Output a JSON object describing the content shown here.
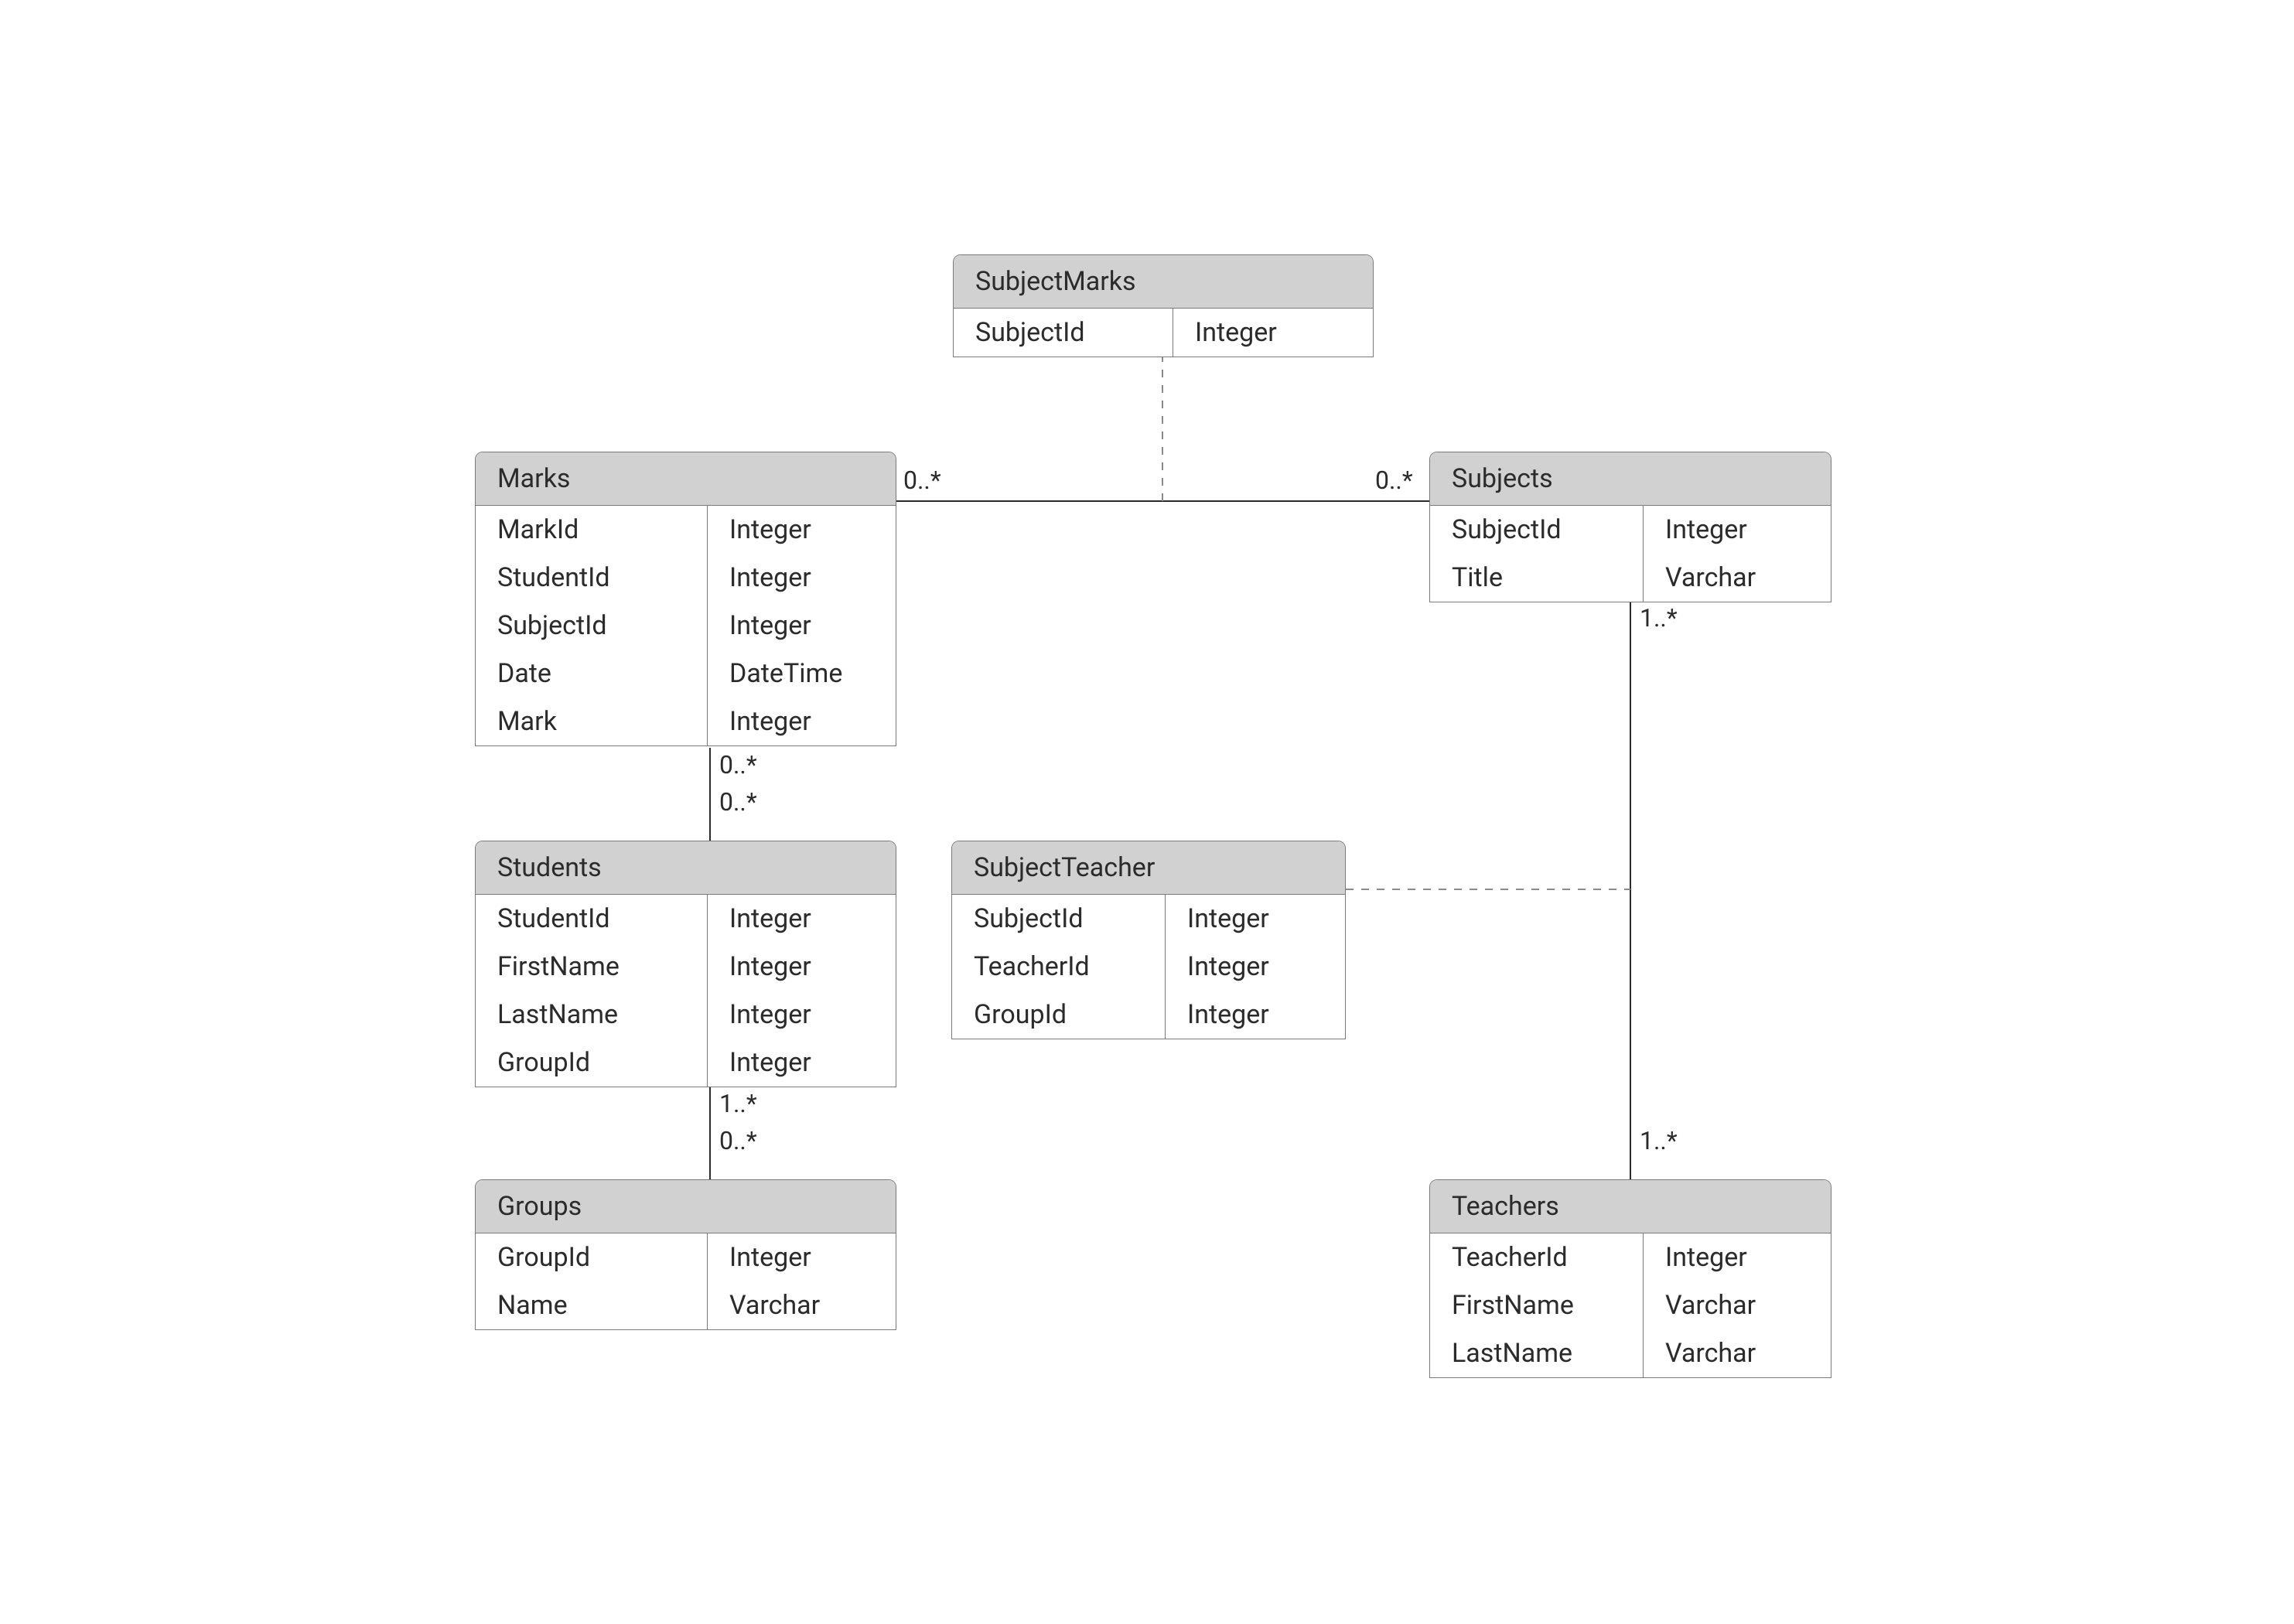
{
  "entities": {
    "subjectMarks": {
      "title": "SubjectMarks",
      "rows": [
        {
          "name": "SubjectId",
          "type": "Integer"
        }
      ]
    },
    "marks": {
      "title": "Marks",
      "rows": [
        {
          "name": "MarkId",
          "type": "Integer"
        },
        {
          "name": "StudentId",
          "type": "Integer"
        },
        {
          "name": "SubjectId",
          "type": "Integer"
        },
        {
          "name": "Date",
          "type": "DateTime"
        },
        {
          "name": "Mark",
          "type": "Integer"
        }
      ]
    },
    "subjects": {
      "title": "Subjects",
      "rows": [
        {
          "name": "SubjectId",
          "type": "Integer"
        },
        {
          "name": "Title",
          "type": "Varchar"
        }
      ]
    },
    "students": {
      "title": "Students",
      "rows": [
        {
          "name": "StudentId",
          "type": "Integer"
        },
        {
          "name": "FirstName",
          "type": "Integer"
        },
        {
          "name": "LastName",
          "type": "Integer"
        },
        {
          "name": "GroupId",
          "type": "Integer"
        }
      ]
    },
    "subjectTeacher": {
      "title": "SubjectTeacher",
      "rows": [
        {
          "name": "SubjectId",
          "type": "Integer"
        },
        {
          "name": "TeacherId",
          "type": "Integer"
        },
        {
          "name": "GroupId",
          "type": "Integer"
        }
      ]
    },
    "groups": {
      "title": "Groups",
      "rows": [
        {
          "name": "GroupId",
          "type": "Integer"
        },
        {
          "name": "Name",
          "type": "Varchar"
        }
      ]
    },
    "teachers": {
      "title": "Teachers",
      "rows": [
        {
          "name": "TeacherId",
          "type": "Integer"
        },
        {
          "name": "FirstName",
          "type": "Varchar"
        },
        {
          "name": "LastName",
          "type": "Varchar"
        }
      ]
    }
  },
  "multiplicities": {
    "marks_to_subjects_left": "0..*",
    "marks_to_subjects_right": "0..*",
    "marks_to_students_top": "0..*",
    "marks_to_students_bottom": "0..*",
    "students_to_groups_top": "1..*",
    "students_to_groups_bottom": "0..*",
    "subjects_to_teachers_top": "1..*",
    "subjects_to_teachers_bottom": "1..*"
  }
}
